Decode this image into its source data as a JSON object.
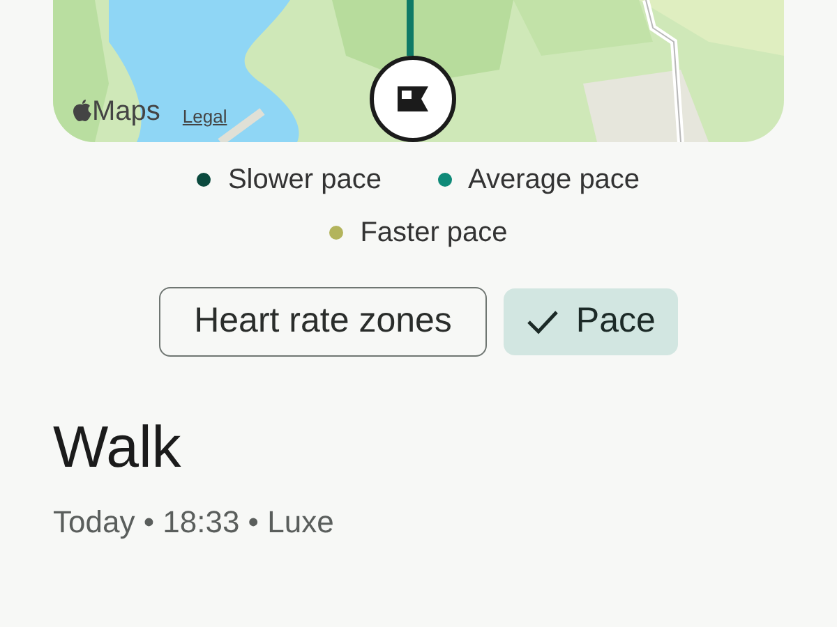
{
  "map": {
    "attribution": "Maps",
    "legal_link": "Legal"
  },
  "legend": [
    {
      "label": "Slower pace",
      "color": "#0b4a3e"
    },
    {
      "label": "Average pace",
      "color": "#0f8a78"
    },
    {
      "label": "Faster pace",
      "color": "#b3b45c"
    }
  ],
  "chips": [
    {
      "label": "Heart rate zones",
      "selected": false
    },
    {
      "label": "Pace",
      "selected": true
    }
  ],
  "activity": {
    "title": "Walk",
    "subtitle": "Today • 18:33 • Luxe"
  }
}
